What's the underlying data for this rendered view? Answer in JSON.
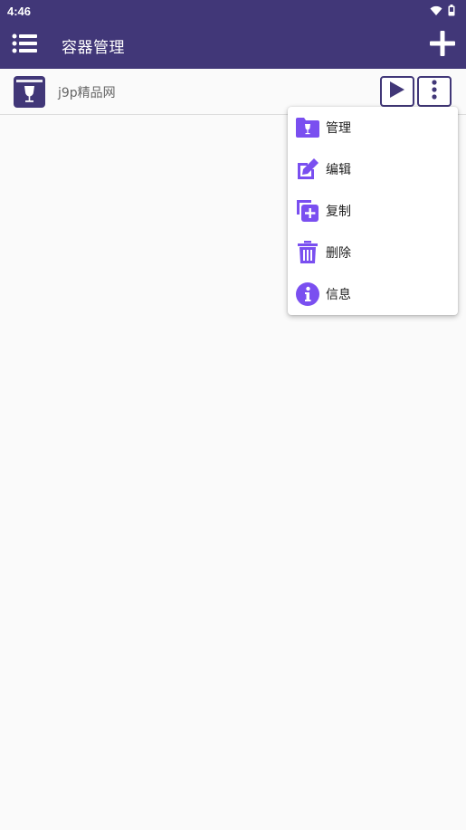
{
  "status_bar": {
    "time": "4:46",
    "icons": [
      "wifi-icon",
      "battery-icon"
    ]
  },
  "app_bar": {
    "title": "容器管理",
    "left_icon": "list-menu-icon",
    "right_icon": "plus-icon"
  },
  "list": {
    "items": [
      {
        "label": "j9p精品网",
        "icon": "wine-glass-box-icon",
        "actions": [
          "play-icon",
          "more-vertical-icon"
        ]
      }
    ]
  },
  "popup_menu": {
    "items": [
      {
        "label": "管理",
        "icon": "folder-wine-icon"
      },
      {
        "label": "编辑",
        "icon": "edit-icon"
      },
      {
        "label": "复制",
        "icon": "copy-add-icon"
      },
      {
        "label": "删除",
        "icon": "trash-icon"
      },
      {
        "label": "信息",
        "icon": "info-icon"
      }
    ]
  },
  "colors": {
    "primary": "#413778",
    "accent": "#7a4ff0",
    "background": "#fafafa"
  }
}
